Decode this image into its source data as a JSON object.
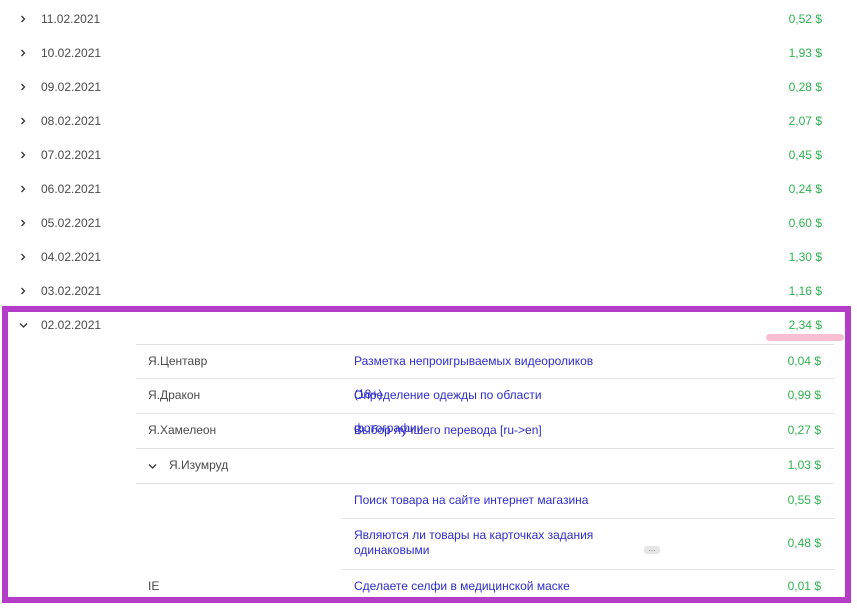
{
  "days": [
    {
      "date": "11.02.2021",
      "amount": "0,52 $",
      "expanded": false
    },
    {
      "date": "10.02.2021",
      "amount": "1,93 $",
      "expanded": false
    },
    {
      "date": "09.02.2021",
      "amount": "0,28 $",
      "expanded": false
    },
    {
      "date": "08.02.2021",
      "amount": "2,07 $",
      "expanded": false
    },
    {
      "date": "07.02.2021",
      "amount": "0,45 $",
      "expanded": false
    },
    {
      "date": "06.02.2021",
      "amount": "0,24 $",
      "expanded": false
    },
    {
      "date": "05.02.2021",
      "amount": "0,60 $",
      "expanded": false
    },
    {
      "date": "04.02.2021",
      "amount": "1,30 $",
      "expanded": false
    },
    {
      "date": "03.02.2021",
      "amount": "1,16 $",
      "expanded": false
    },
    {
      "date": "02.02.2021",
      "amount": "2,34 $",
      "expanded": true
    }
  ],
  "details": [
    {
      "project": "Я.Центавр",
      "task": "Разметка непроигрываемых видеороликов (18+)",
      "amount": "0,04 $"
    },
    {
      "project": "Я.Дракон",
      "task": "Определение одежды по области фотографии",
      "amount": "0,99 $"
    },
    {
      "project": "Я.Хамелеон",
      "task": "Выбор лучшего перевода [ru->en]",
      "amount": "0,27 $"
    },
    {
      "project": "Я.Изумруд",
      "task": "",
      "amount": "1,03 $",
      "expanded": true
    },
    {
      "project": "",
      "task": "Поиск товара на сайте интернет магазина",
      "amount": "0,55 $"
    },
    {
      "project": "",
      "task": "Являются ли товары на карточках задания одинаковыми",
      "amount": "0,48 $",
      "more": "..."
    },
    {
      "project": "IE",
      "task": "Сделаете селфи в медицинской маске",
      "amount": "0,01 $"
    }
  ],
  "colors": {
    "amount": "#2fb24f",
    "link": "#2d2dc8",
    "highlight": "#b33dc6"
  },
  "icons": {
    "collapsed": "chevron-right-icon",
    "expanded": "chevron-down-icon"
  }
}
